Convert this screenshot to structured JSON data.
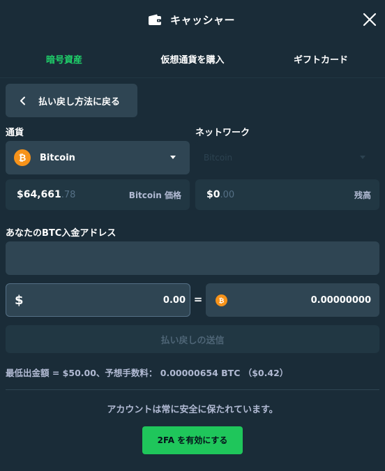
{
  "header": {
    "title": "キャッシャー",
    "wallet_icon": "wallet-icon",
    "close_icon": "close-icon"
  },
  "tabs": [
    {
      "label": "暗号資産",
      "active": true
    },
    {
      "label": "仮想通貨を購入",
      "active": false
    },
    {
      "label": "ギフトカード",
      "active": false
    }
  ],
  "back_button": {
    "label": "払い戻し方法に戻る",
    "icon": "chevron-left-icon"
  },
  "currency": {
    "label": "通貨",
    "selected": "Bitcoin",
    "icon": "bitcoin-icon"
  },
  "network": {
    "label": "ネットワーク",
    "selected": "Bitcoin",
    "disabled": true
  },
  "price": {
    "whole": "$64,661",
    "decimals": ".78",
    "label": "Bitcoin 価格"
  },
  "balance": {
    "whole": "$0",
    "decimals": ".00",
    "label": "残高"
  },
  "address": {
    "label": "あなたのBTC入金アドレス",
    "value": "",
    "placeholder": ""
  },
  "amount": {
    "currency_symbol": "$",
    "usd_value": "0.00",
    "equals": "=",
    "btc_value": "0.00000000"
  },
  "submit_button": {
    "label": "払い戻しの送信",
    "disabled": true
  },
  "fee_text": "最低出金額 = $50.00、予想手数料： 0.00000654 BTC （$0.42）",
  "security": {
    "text": "アカウントは常に安全に保たれています。",
    "button_label": "2FA を有効にする"
  },
  "colors": {
    "background": "#1a2c38",
    "panel": "#2f4553",
    "panel_dark": "#213743",
    "accent_green": "#1fd16a",
    "bitcoin_orange": "#f7931a"
  }
}
